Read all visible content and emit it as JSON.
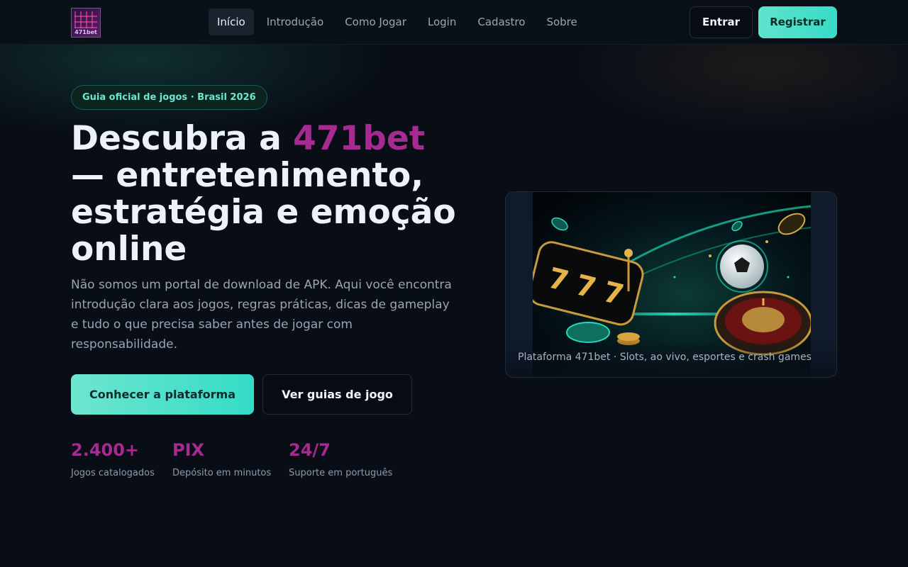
{
  "header": {
    "logo_text": "471bet",
    "nav": [
      {
        "label": "Início",
        "active": true
      },
      {
        "label": "Introdução",
        "active": false
      },
      {
        "label": "Como Jogar",
        "active": false
      },
      {
        "label": "Login",
        "active": false
      },
      {
        "label": "Cadastro",
        "active": false
      },
      {
        "label": "Sobre",
        "active": false
      }
    ],
    "login_label": "Entrar",
    "register_label": "Registrar"
  },
  "hero": {
    "badge": " Guia oficial de jogos · Brasil 2026",
    "headline_pre": "Descubra a ",
    "headline_brand": "471bet",
    "headline_post": " — entretenimento, estratégia e emoção online",
    "description": "Não somos um portal de download de APK. Aqui você encontra introdução clara aos jogos, regras práticas, dicas de gameplay e tudo o que precisa saber antes de jogar com responsabilidade.",
    "cta_primary": "Conhecer a plataforma",
    "cta_secondary": "Ver guias de jogo",
    "stats": [
      {
        "value": "2.400+",
        "label": "Jogos catalogados"
      },
      {
        "value": "PIX",
        "label": "Depósito em minutos"
      },
      {
        "value": "24/7",
        "label": "Suporte em português"
      }
    ]
  },
  "card": {
    "caption": "Plataforma 471bet · Slots, ao vivo, esportes e crash games"
  },
  "colors": {
    "accent_teal": "#36dcc6",
    "brand_magenta": "#a62a8f",
    "background": "#080d16"
  }
}
